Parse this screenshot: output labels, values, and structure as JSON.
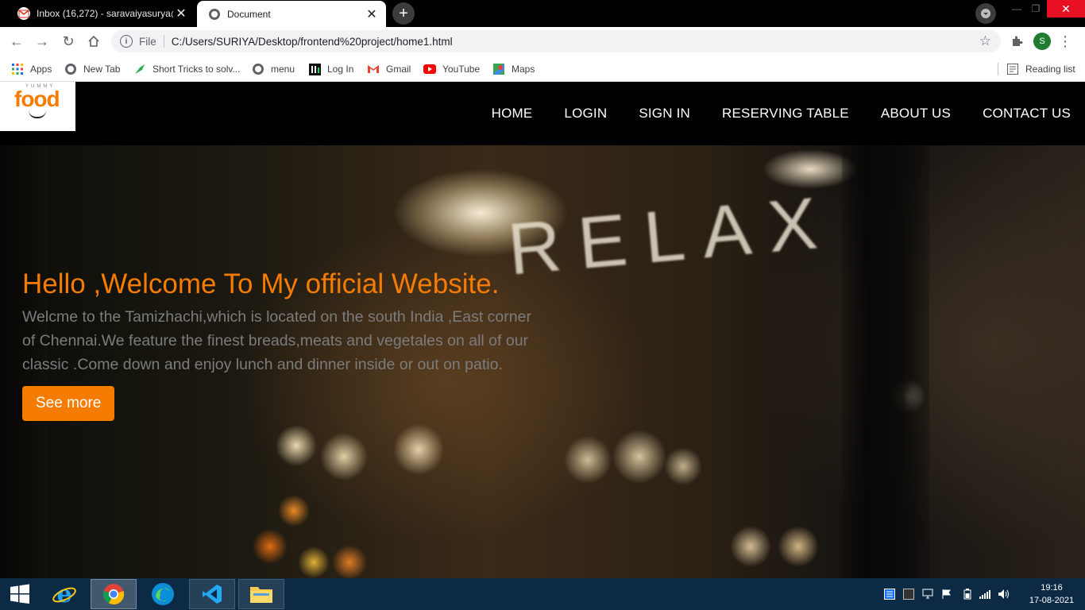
{
  "browser": {
    "tabs": [
      {
        "title": "Inbox (16,272) - saravaiyasurya@",
        "active": false
      },
      {
        "title": "Document",
        "active": true
      }
    ],
    "address": {
      "scheme_label": "File",
      "url": "C:/Users/SURIYA/Desktop/frontend%20project/home1.html"
    },
    "profile_initial": "S",
    "bookmarks": [
      {
        "label": "Apps",
        "icon": "apps-grid-icon"
      },
      {
        "label": "New Tab",
        "icon": "globe-icon"
      },
      {
        "label": "Short Tricks to solv...",
        "icon": "bookmark-leaf-icon"
      },
      {
        "label": "menu",
        "icon": "globe-icon"
      },
      {
        "label": "Log In",
        "icon": "login-site-icon"
      },
      {
        "label": "Gmail",
        "icon": "gmail-icon"
      },
      {
        "label": "YouTube",
        "icon": "youtube-icon"
      },
      {
        "label": "Maps",
        "icon": "maps-icon"
      }
    ],
    "reading_list": "Reading list"
  },
  "site": {
    "logo": {
      "brand": "food",
      "tagline": "YUMMY"
    },
    "nav": [
      "HOME",
      "LOGIN",
      "SIGN IN",
      "RESERVING TABLE",
      "ABOUT US",
      "CONTACT US"
    ],
    "hero": {
      "sign_text": "RELAX",
      "title": "Hello ,Welcome To My official Website.",
      "body": "Welcme to the Tamizhachi,which is located on the south India ,East corner of Chennai.We feature the finest breads,meats and vegetales on all of our classic .Come down and enjoy lunch and dinner inside or out on patio.",
      "cta": "See more"
    },
    "colors": {
      "accent": "#f57c00",
      "nav_bg": "#000000",
      "body_text": "#7c7c7c"
    }
  },
  "taskbar": {
    "apps": [
      "windows-start-icon",
      "internet-explorer-icon",
      "chrome-icon",
      "edge-icon",
      "vscode-icon",
      "file-explorer-icon"
    ],
    "clock": {
      "time": "19:16",
      "date": "17-08-2021"
    }
  }
}
